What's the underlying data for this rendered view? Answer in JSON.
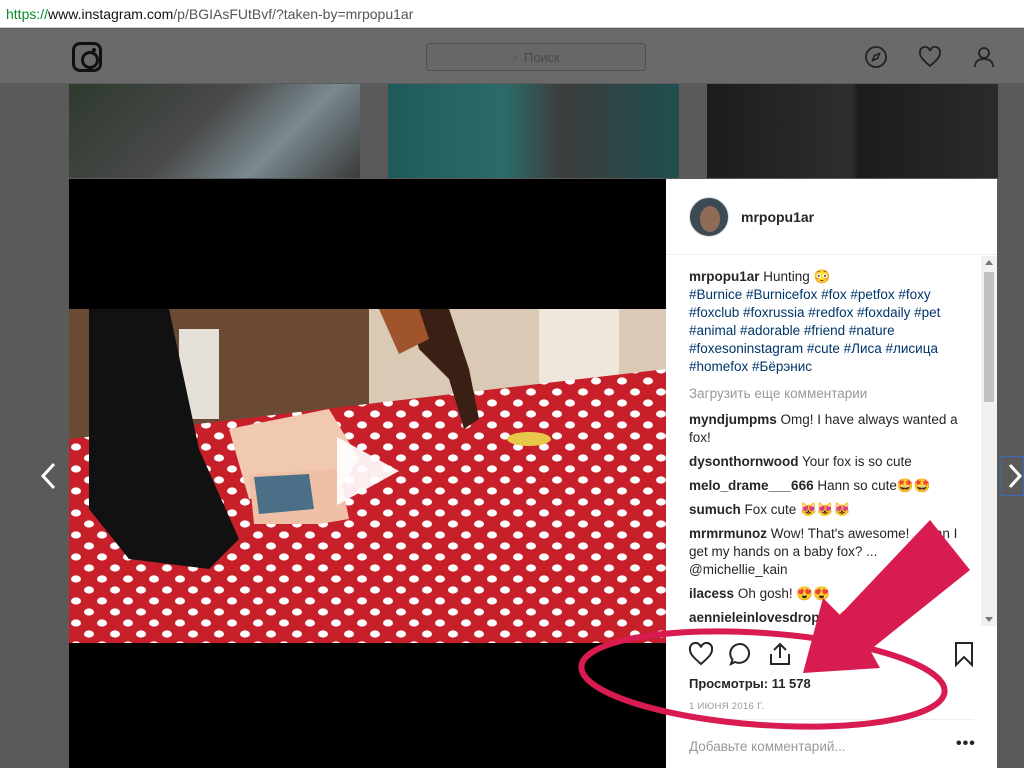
{
  "browser": {
    "url_scheme": "https://",
    "url_host": "www.instagram.com",
    "url_path": "/p/BGIAsFUtBvf/?taken-by=mrpopu1ar"
  },
  "nav": {
    "search_placeholder": "Поиск"
  },
  "post": {
    "username": "mrpopu1ar",
    "caption_user": "mrpopu1ar",
    "caption_text": "Hunting 😳",
    "hashtags": "#Burnice #Burnicefox #fox #petfox #foxy #foxclub #foxrussia #redfox #foxdaily #pet #animal #adorable #friend #nature #foxesoninstagram #cute #Лиса #лисица #homefox #Бёрэнис",
    "load_more": "Загрузить еще комментарии",
    "comments": [
      {
        "user": "myndjumpms",
        "text": "Omg! I have always wanted a fox!"
      },
      {
        "user": "dysonthornwood",
        "text": "Your fox is so cute"
      },
      {
        "user": "melo_drame___666",
        "text": "Hann so cute🤩🤩"
      },
      {
        "user": "sumuch",
        "text": "Fox cute 😻😻😻"
      },
      {
        "user": "mrmrmunoz",
        "text": "Wow! That's awesome! ... can I get my hands on a baby fox? ... @michellie_kain"
      },
      {
        "user": "ilacess",
        "text": "Oh gosh! 😍😍"
      },
      {
        "user": "aennieleinlovesdrop",
        "text": "... 😍😍"
      }
    ],
    "views_label": "Просмотры: 11 578",
    "date": "1 ИЮНЯ 2016 Г.",
    "add_comment_placeholder": "Добавьте комментарий...",
    "more": "•••"
  },
  "icons": {
    "logo": "instagram-logo-icon",
    "search": "search-icon",
    "explore": "compass-icon",
    "activity": "heart-icon",
    "profile": "person-icon",
    "like": "heart-outline-icon",
    "comment": "speech-bubble-icon",
    "share": "share-icon",
    "save": "bookmark-icon",
    "prev": "chevron-left-icon",
    "next": "chevron-right-icon",
    "play": "play-icon"
  },
  "colors": {
    "annotation": "#d81b50",
    "hashtag": "#003569",
    "url_scheme": "#0a8a2a"
  }
}
